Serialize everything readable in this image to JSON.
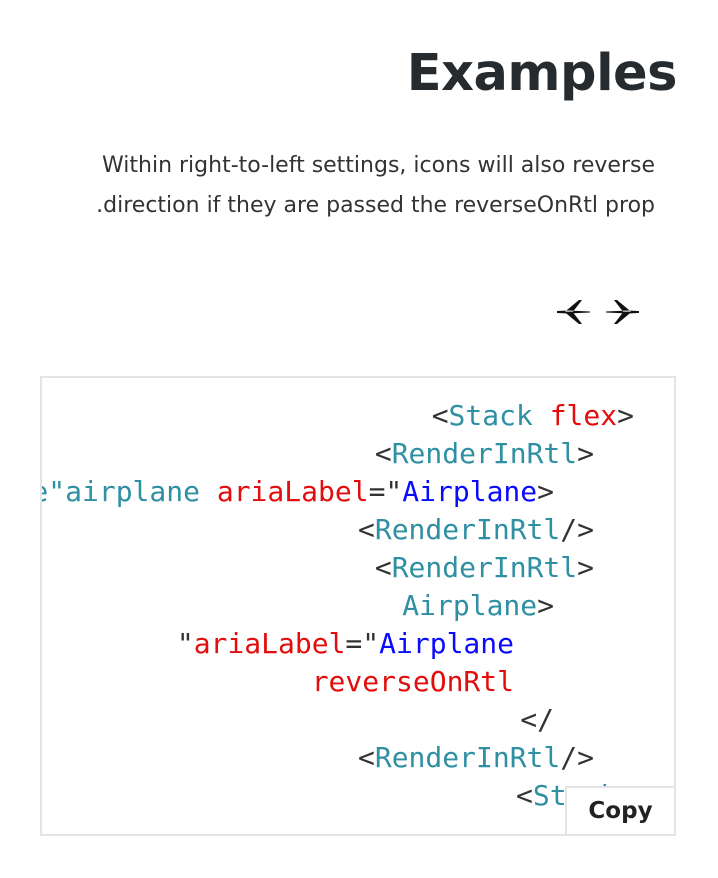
{
  "heading": "Examples",
  "description": {
    "line1": "Within right-to-left settings, icons will also reverse",
    "line2": ".direction if they are passed the reverseOnRtl prop"
  },
  "icons": [
    {
      "name": "airplane-left-icon",
      "label": "Airplane"
    },
    {
      "name": "airplane-right-icon",
      "label": "Airplane"
    }
  ],
  "code": {
    "lines": [
      [
        [
          "p",
          "<"
        ],
        [
          "t",
          "Stack"
        ],
        [
          "p",
          " "
        ],
        [
          "a",
          "flex"
        ],
        [
          "p",
          ">"
        ]
      ],
      [
        [
          "p",
          "<"
        ],
        [
          "t",
          "RenderInRtl"
        ],
        [
          "p",
          ">"
        ]
      ],
      [
        [
          "t",
          "<Icon icon=\"airplane\"airplane"
        ],
        [
          "p",
          " "
        ],
        [
          "a",
          "ariaLabel"
        ],
        [
          "p",
          "=\""
        ],
        [
          "s",
          "Airplane"
        ],
        [
          "p",
          ">"
        ]
      ],
      [
        [
          "p",
          "<"
        ],
        [
          "t",
          "RenderInRtl"
        ],
        [
          "p",
          "/>"
        ]
      ],
      [
        [
          "p",
          "<"
        ],
        [
          "t",
          "RenderInRtl"
        ],
        [
          "p",
          ">"
        ]
      ],
      [
        [
          "t",
          "Airplane"
        ],
        [
          "p",
          ">"
        ]
      ],
      [
        [
          "p",
          "\""
        ],
        [
          "a",
          "ariaLabel"
        ],
        [
          "p",
          "=\""
        ],
        [
          "s",
          "Airplane"
        ]
      ],
      [
        [
          "a",
          "reverseOnRtl"
        ]
      ],
      [
        [
          "p",
          "</"
        ]
      ],
      [
        [
          "p",
          "<"
        ],
        [
          "t",
          "RenderInRtl"
        ],
        [
          "p",
          "/>"
        ]
      ],
      [
        [
          "p",
          "<"
        ],
        [
          "t",
          "Stack"
        ],
        [
          "p",
          ">"
        ]
      ]
    ]
  },
  "copy_label": "Copy",
  "colors": {
    "tag": "#2f8fa3",
    "attribute": "#e20e0e",
    "string": "#0a0aff",
    "punctuation": "#333333"
  }
}
